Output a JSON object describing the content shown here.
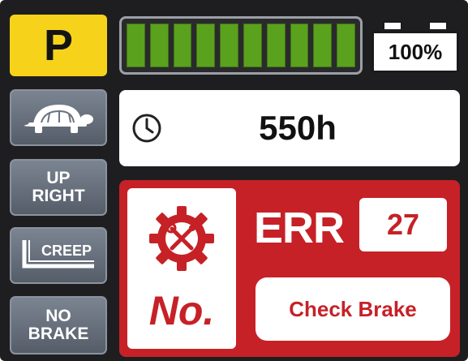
{
  "mode": {
    "label": "P",
    "color": "#f6d21b"
  },
  "side_buttons": {
    "slow_mode": {
      "icon": "turtle-icon"
    },
    "upright": {
      "line1": "UP",
      "line2": "RIGHT"
    },
    "creep": {
      "label": "CREEP",
      "icon": "creep-icon"
    },
    "no_brake": {
      "line1": "NO",
      "line2": "BRAKE"
    }
  },
  "battery": {
    "segments_lit": 10,
    "segments_total": 10,
    "percent_label": "100%",
    "fill_color": "#5aa11e"
  },
  "hour_meter": {
    "icon": "clock-icon",
    "value": "550h"
  },
  "error": {
    "icon": "gear-wrench-icon",
    "no_label": "No.",
    "err_label": "ERR",
    "code": "27",
    "message": "Check Brake",
    "panel_color": "#c62127"
  }
}
